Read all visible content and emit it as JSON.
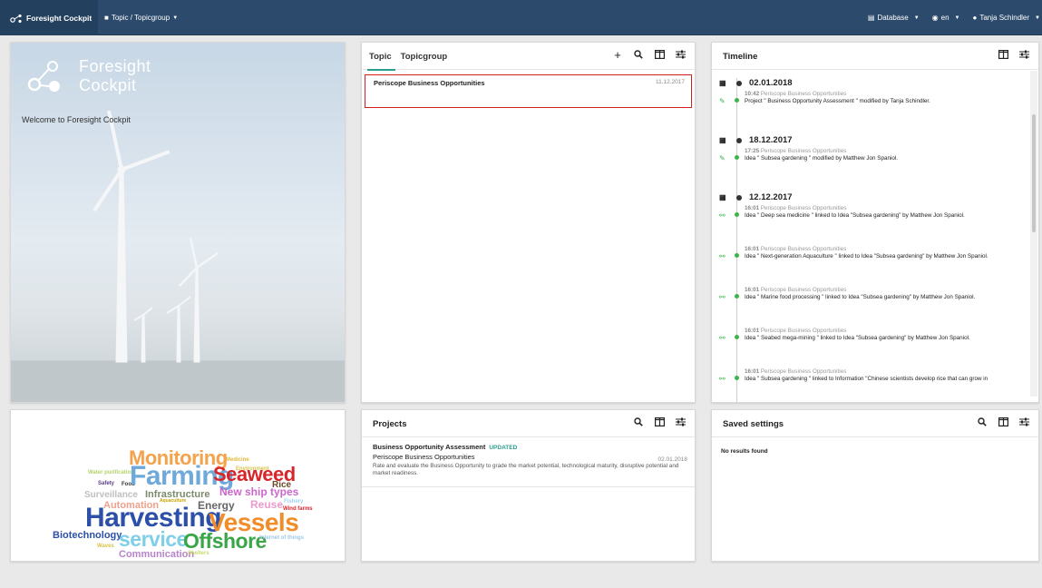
{
  "navbar": {
    "brand": "Foresight Cockpit",
    "topic_menu": "Topic / Topicgroup",
    "database": "Database",
    "language": "en",
    "user": "Tanja Schindler"
  },
  "welcome": {
    "logo_line1": "Foresight",
    "logo_line2": "Cockpit",
    "greeting": "Welcome to Foresight Cockpit"
  },
  "topic_panel": {
    "tabs": [
      "Topic",
      "Topicgroup"
    ],
    "items": [
      {
        "name": "Periscope Business Opportunities",
        "date": "11.12.2017"
      }
    ]
  },
  "projects_panel": {
    "title": "Projects",
    "items": [
      {
        "title": "Business Opportunity Assessment",
        "badge": "UPDATED",
        "topic": "Periscope Business Opportunities",
        "date": "02.01.2018",
        "description": "Rate and evaluate the Business Opportunity to grade the market potential, technological maturity, disruptive potential and market readiness."
      }
    ]
  },
  "timeline_panel": {
    "title": "Timeline",
    "groups": [
      {
        "date": "02.01.2018",
        "entries": [
          {
            "icon": "pencil-icon",
            "time": "10:42",
            "topic": "Periscope Business Opportunities",
            "text": "Project \" Business Opportunity Assessment \" modified by Tanja Schindler."
          }
        ]
      },
      {
        "date": "18.12.2017",
        "entries": [
          {
            "icon": "pencil-icon",
            "time": "17:25",
            "topic": "Periscope Business Opportunities",
            "text": "Idea \" Subsea gardening \" modified by Matthew Jon Spaniol."
          }
        ]
      },
      {
        "date": "12.12.2017",
        "entries": [
          {
            "icon": "link-icon",
            "time": "16:01",
            "topic": "Periscope Business Opportunities",
            "text": "Idea \" Deep sea medicine \" linked to Idea \"Subsea gardening\" by Matthew Jon Spaniol."
          },
          {
            "icon": "link-icon",
            "time": "16:01",
            "topic": "Periscope Business Opportunities",
            "text": "Idea \" Next-generation Aquaculture \" linked to Idea \"Subsea gardening\" by Matthew Jon Spaniol."
          },
          {
            "icon": "link-icon",
            "time": "16:01",
            "topic": "Periscope Business Opportunities",
            "text": "Idea \" Marine food processing \" linked to Idea \"Subsea gardening\" by Matthew Jon Spaniol."
          },
          {
            "icon": "link-icon",
            "time": "16:01",
            "topic": "Periscope Business Opportunities",
            "text": "Idea \" Seabed mega-mining \" linked to Idea \"Subsea gardening\" by Matthew Jon Spaniol."
          },
          {
            "icon": "link-icon",
            "time": "16:01",
            "topic": "Periscope Business Opportunities",
            "text": "Idea \" Subsea gardening \" linked to Information \"Chinese scientists develop rice that can grow in"
          }
        ]
      }
    ]
  },
  "saved_settings_panel": {
    "title": "Saved settings",
    "empty_text": "No results found"
  },
  "word_cloud": [
    {
      "text": "Monitoring",
      "color": "#f4a24b"
    },
    {
      "text": "Medicine",
      "color": "#e0b83a"
    },
    {
      "text": "Water purification",
      "color": "#b7d36b"
    },
    {
      "text": "Environment",
      "color": "#d9c44a"
    },
    {
      "text": "Safety",
      "color": "#5a3a8a"
    },
    {
      "text": "Food",
      "color": "#333333"
    },
    {
      "text": "Farming",
      "color": "#6ea9d9"
    },
    {
      "text": "Seaweed",
      "color": "#d7262b"
    },
    {
      "text": "Rice",
      "color": "#6b4a2b"
    },
    {
      "text": "Surveillance",
      "color": "#bfbfbf"
    },
    {
      "text": "Infrastructure",
      "color": "#7a8a6a"
    },
    {
      "text": "New ship types",
      "color": "#cc66cc"
    },
    {
      "text": "Automation",
      "color": "#f0a08c"
    },
    {
      "text": "Aquaculture",
      "color": "#c8a400"
    },
    {
      "text": "Energy",
      "color": "#666666"
    },
    {
      "text": "Reuse",
      "color": "#ee99cc"
    },
    {
      "text": "Fishery",
      "color": "#9ed3f0"
    },
    {
      "text": "Wind farms",
      "color": "#d7262b"
    },
    {
      "text": "Harvesting",
      "color": "#2c4fa8"
    },
    {
      "text": "Vessels",
      "color": "#f28c28"
    },
    {
      "text": "Biotechnology",
      "color": "#2c4fa8"
    },
    {
      "text": "Waves",
      "color": "#d7c24a"
    },
    {
      "text": "service",
      "color": "#7fcfe8"
    },
    {
      "text": "Offshore",
      "color": "#3aa648"
    },
    {
      "text": "Internet of things",
      "color": "#9ec9e8"
    },
    {
      "text": "Communication",
      "color": "#b784c9"
    },
    {
      "text": "Shelters",
      "color": "#c8d96a"
    }
  ]
}
